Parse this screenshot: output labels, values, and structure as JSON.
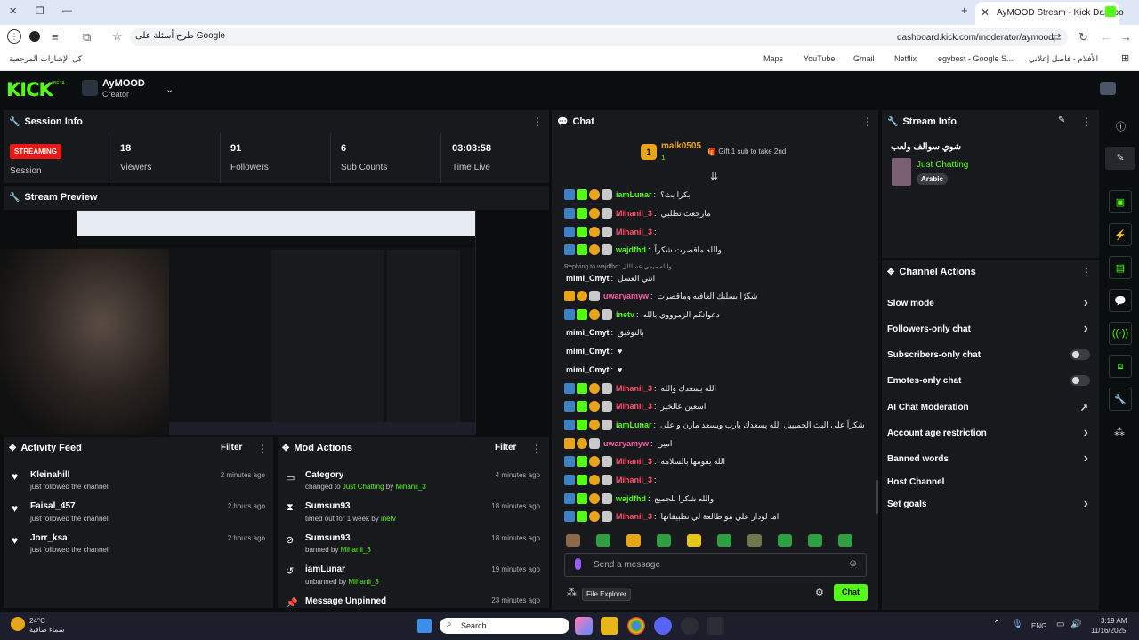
{
  "browser": {
    "tab_title": "AyMOOD Stream - Kick Dashbo",
    "search_text": "طرح أسئلة على Google",
    "url": "dashboard.kick.com/moderator/aymood",
    "bookmarks": [
      {
        "label": "Maps"
      },
      {
        "label": "YouTube"
      },
      {
        "label": "Gmail"
      },
      {
        "label": "Netflix"
      },
      {
        "label": "egybest - Google S..."
      },
      {
        "label": "الأفلام - فاصل إعلاني"
      },
      {
        "label": "كل الإشارات المرجعية"
      }
    ]
  },
  "header": {
    "logo": "KICK",
    "logo_badge": "BETA",
    "channel_name": "AyMOOD",
    "channel_role": "Creator"
  },
  "session": {
    "title": "Session Info",
    "status": "STREAMING",
    "status_label": "Session",
    "stats": [
      {
        "value": "18",
        "label": "Viewers"
      },
      {
        "value": "91",
        "label": "Followers"
      },
      {
        "value": "6",
        "label": "Sub Counts"
      },
      {
        "value": "03:03:58",
        "label": "Time Live"
      }
    ]
  },
  "preview": {
    "title": "Stream Preview"
  },
  "activity": {
    "title": "Activity Feed",
    "filter": "Filter",
    "items": [
      {
        "name": "Kleinahill",
        "desc": "just followed the channel",
        "time": "2 minutes ago"
      },
      {
        "name": "Faisal_457",
        "desc": "just followed the channel",
        "time": "2 hours ago"
      },
      {
        "name": "Jorr_ksa",
        "desc": "just followed the channel",
        "time": "2 hours ago"
      }
    ]
  },
  "modactions": {
    "title": "Mod Actions",
    "filter": "Filter",
    "items": [
      {
        "title": "Category",
        "pre": "changed to",
        "target": "Just Chatting",
        "by": "by",
        "actor": "Mihanii_3",
        "time": "4 minutes ago"
      },
      {
        "title": "Sumsun93",
        "pre": "timed out for 1 week by",
        "target": "",
        "by": "",
        "actor": "inetv",
        "time": "18 minutes ago"
      },
      {
        "title": "Sumsun93",
        "pre": "banned by",
        "target": "",
        "by": "",
        "actor": "Mihanii_3",
        "time": "18 minutes ago"
      },
      {
        "title": "iamLunar",
        "pre": "unbanned by",
        "target": "",
        "by": "",
        "actor": "Mihanii_3",
        "time": "19 minutes ago"
      },
      {
        "title": "Message Unpinned",
        "pre": "",
        "target": "",
        "by": "",
        "actor": "",
        "time": "23 minutes ago"
      }
    ]
  },
  "chat": {
    "title": "Chat",
    "pinned_user": "malk0505",
    "pinned_count": "1",
    "gift_text": "Gift 1 sub to take 2nd",
    "reply_prefix": "Replying to wajdfhd:",
    "reply_text": "والله ميمي عسلللل",
    "messages": [
      {
        "user": "iamLunar",
        "color": "green",
        "text": "بكرا بث؟"
      },
      {
        "user": "Mihanii_3",
        "color": "red",
        "text": "مارجعت تطلبي"
      },
      {
        "user": "Mihanii_3",
        "color": "red",
        "text": ""
      },
      {
        "user": "wajdfhd",
        "color": "green",
        "text": "والله ماقصرت شكراً"
      },
      {
        "user": "mimi_Cmyt",
        "color": "white",
        "text": "انتي العسل"
      },
      {
        "user": "uwaryamyw",
        "color": "gold",
        "text": "شكرًا يسلبك العافيه وماقصرت"
      },
      {
        "user": "inetv",
        "color": "green",
        "text": "دعواتكم الزموووي بالله"
      },
      {
        "user": "mimi_Cmyt",
        "color": "white",
        "text": "بالتوفيق"
      },
      {
        "user": "mimi_Cmyt",
        "color": "white",
        "text": "♥"
      },
      {
        "user": "mimi_Cmyt",
        "color": "white",
        "text": "♥"
      },
      {
        "user": "Mihanii_3",
        "color": "red",
        "text": "الله يسعدك والله"
      },
      {
        "user": "Mihanii_3",
        "color": "red",
        "text": "اسعين عالخير"
      },
      {
        "user": "iamLunar",
        "color": "green",
        "text": "شكراً على البث الجميييل الله يسعدك يارب ويسعد مازن و على"
      },
      {
        "user": "uwaryamyw",
        "color": "gold",
        "text": "امين"
      },
      {
        "user": "Mihanii_3",
        "color": "red",
        "text": "الله يقومها بالسلامة"
      },
      {
        "user": "Mihanii_3",
        "color": "red",
        "text": ""
      },
      {
        "user": "wajdfhd",
        "color": "green",
        "text": "والله شكرا للجميع"
      },
      {
        "user": "Mihanii_3",
        "color": "red",
        "text": "اما لودار علي مو طالعة لي تطبيقاتها"
      }
    ],
    "input_placeholder": "Send a message",
    "send_label": "Chat",
    "tooltip": "File Explorer"
  },
  "stream_info": {
    "title": "Stream Info",
    "stream_title": "شوي سوالف ولعب",
    "category": "Just Chatting",
    "tag": "Arabic"
  },
  "channel_actions": {
    "title": "Channel Actions",
    "items": [
      {
        "label": "Slow mode",
        "kind": "chevron"
      },
      {
        "label": "Followers-only chat",
        "kind": "chevron"
      },
      {
        "label": "Subscribers-only chat",
        "kind": "toggle"
      },
      {
        "label": "Emotes-only chat",
        "kind": "toggle"
      },
      {
        "label": "AI Chat Moderation",
        "kind": "external"
      },
      {
        "label": "Account age restriction",
        "kind": "chevron"
      },
      {
        "label": "Banned words",
        "kind": "chevron"
      },
      {
        "label": "Host Channel",
        "kind": "none"
      },
      {
        "label": "Set goals",
        "kind": "chevron"
      }
    ]
  },
  "taskbar": {
    "weather_temp": "24°C",
    "weather_desc": "سماء صافية",
    "search": "Search",
    "lang": "ENG",
    "time": "3:19 AM",
    "date": "11/16/2025"
  },
  "colors": {
    "accent": "#53fc18",
    "streaming": "#e91916",
    "panel": "#17191c"
  }
}
